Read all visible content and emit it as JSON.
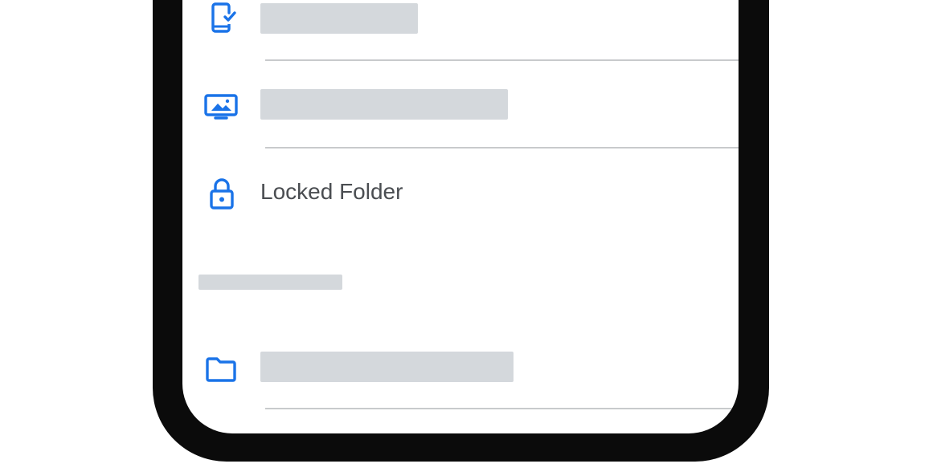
{
  "colors": {
    "accent": "#1a73e8",
    "placeholder": "#d4d8dc",
    "divider": "#c8cacc",
    "text": "#4a4d51",
    "frame": "#0b0b0b"
  },
  "menu": {
    "items": [
      {
        "icon": "phone-check-icon",
        "label": ""
      },
      {
        "icon": "screen-image-icon",
        "label": ""
      },
      {
        "icon": "lock-icon",
        "label": "Locked Folder"
      },
      {
        "icon": "folder-icon",
        "label": ""
      }
    ],
    "section_header": ""
  }
}
